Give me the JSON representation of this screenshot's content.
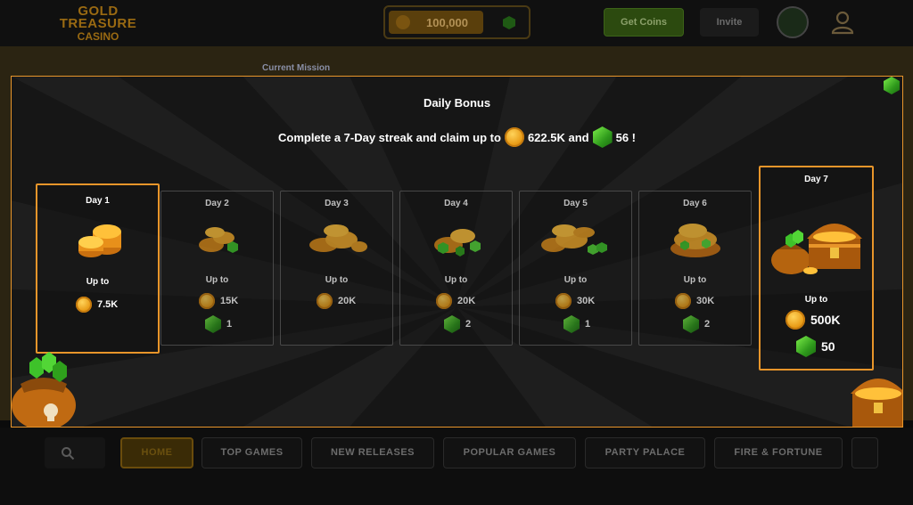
{
  "header": {
    "logo_line1": "GOLD TREASURE",
    "logo_line2": "CASINO",
    "balance": "100,000",
    "get_coins_label": "Get Coins",
    "invite_label": "Invite"
  },
  "banner": {
    "mission_label": "Current Mission"
  },
  "modal": {
    "title": "Daily Bonus",
    "subtitle_pre": "Complete a 7-Day streak and claim up to",
    "subtitle_coins": "622.5K and",
    "subtitle_gems": "56 !",
    "days": [
      {
        "label": "Day 1",
        "upto": "Up to",
        "coins": "7.5K",
        "gems": null
      },
      {
        "label": "Day 2",
        "upto": "Up to",
        "coins": "15K",
        "gems": "1"
      },
      {
        "label": "Day 3",
        "upto": "Up to",
        "coins": "20K",
        "gems": null
      },
      {
        "label": "Day 4",
        "upto": "Up to",
        "coins": "20K",
        "gems": "2"
      },
      {
        "label": "Day 5",
        "upto": "Up to",
        "coins": "30K",
        "gems": "1"
      },
      {
        "label": "Day 6",
        "upto": "Up to",
        "coins": "30K",
        "gems": "2"
      },
      {
        "label": "Day 7",
        "upto": "Up to",
        "coins": "500K",
        "gems": "50"
      }
    ]
  },
  "nav": {
    "tabs": [
      "HOME",
      "TOP GAMES",
      "NEW RELEASES",
      "POPULAR GAMES",
      "PARTY PALACE",
      "FIRE & FORTUNE"
    ],
    "active_tab": "HOME"
  },
  "colors": {
    "accent_orange": "#e8952a",
    "coin_gold": "#f0a820",
    "gem_green": "#3ec22a"
  }
}
